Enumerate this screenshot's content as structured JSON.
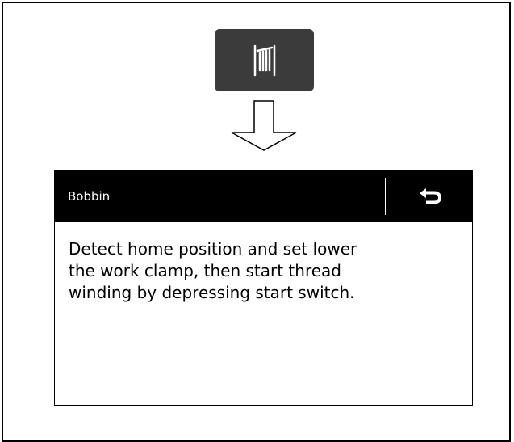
{
  "bobbin_button": {
    "icon": "bobbin-icon",
    "background": "#3b3b3b"
  },
  "arrow": {
    "icon": "down-arrow-icon"
  },
  "dialog": {
    "title": "Bobbin",
    "back_icon": "return-icon",
    "message": "Detect home position and set lower\nthe work clamp, then start thread\nwinding by depressing start switch.",
    "header_color": "#000000",
    "text_color": "#ffffff"
  }
}
